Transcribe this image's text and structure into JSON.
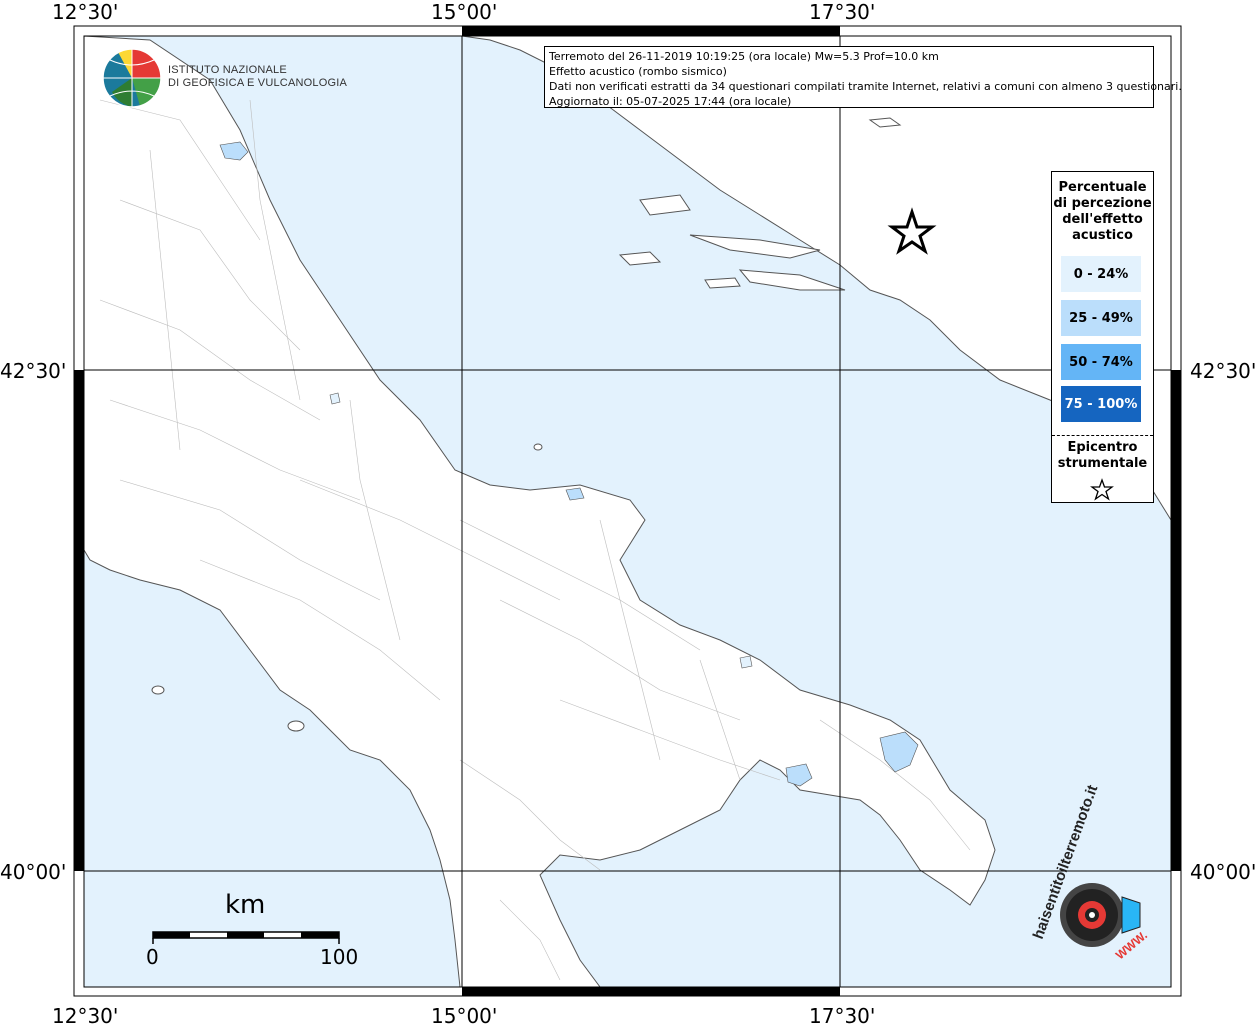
{
  "info": {
    "line1": "Terremoto del 26-11-2019 10:19:25 (ora locale) Mw=5.3 Prof=10.0 km",
    "line2": "Effetto acustico (rombo sismico)",
    "line3": "Dati non verificati estratti da 34 questionari compilati tramite Internet, relativi a comuni con almeno 3 questionari.",
    "line4": "Aggiornato il: 05-07-2025 17:44 (ora locale)"
  },
  "logo": {
    "line1": "ISTITUTO NAZIONALE",
    "line2": "DI GEOFISICA E VULCANOLOGIA"
  },
  "axes": {
    "top": [
      "12°30'",
      "15°00'",
      "17°30'"
    ],
    "bottom": [
      "12°30'",
      "15°00'",
      "17°30'"
    ],
    "left": [
      "42°30'",
      "40°00'"
    ],
    "right": [
      "42°30'",
      "40°00'"
    ]
  },
  "legend": {
    "title_l1": "Percentuale",
    "title_l2": "di percezione",
    "title_l3": "dell'effetto",
    "title_l4": "acustico",
    "classes": [
      {
        "label": "0 - 24%",
        "color": "#e3f2fd",
        "text_color": "#000000"
      },
      {
        "label": "25 - 49%",
        "color": "#bbdefb",
        "text_color": "#000000"
      },
      {
        "label": "50 - 74%",
        "color": "#64b5f6",
        "text_color": "#000000"
      },
      {
        "label": "75 - 100%",
        "color": "#1565c0",
        "text_color": "#ffffff"
      }
    ],
    "epi_l1": "Epicentro",
    "epi_l2": "strumentale"
  },
  "scale": {
    "unit": "km",
    "min": "0",
    "max": "100"
  },
  "watermark": {
    "text": "haisentitoilterremoto.it",
    "url": "WWW."
  },
  "colors": {
    "sea": "#e3f2fd",
    "land": "#ffffff",
    "border": "#9e9e9e"
  }
}
